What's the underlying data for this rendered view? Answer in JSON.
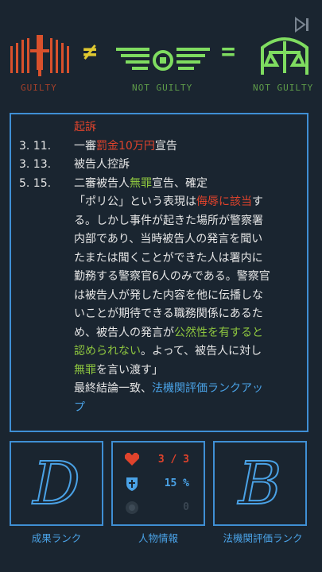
{
  "verdict_bar": {
    "guilty_label": "GUILTY",
    "not_equal_symbol": "≠",
    "not_guilty_label": "NOT GUILTY",
    "equals_symbol": "=",
    "result_label": "NOT GUILTY",
    "colors": {
      "guilty": "#d9512c",
      "not_guilty": "#7fdc60"
    },
    "icons": [
      "skip-icon",
      "guilty-sword-icon",
      "not-guilty-wings-icon",
      "not-guilty-scales-icon"
    ]
  },
  "record": {
    "header": "起訴",
    "entries": [
      {
        "date": "3. 11.",
        "parts": [
          {
            "t": "一審"
          },
          {
            "t": "罰金10万円",
            "c": "red"
          },
          {
            "t": "宣告"
          }
        ]
      },
      {
        "date": "3. 13.",
        "parts": [
          {
            "t": "被告人控訴"
          }
        ]
      },
      {
        "date": "5. 15.",
        "parts": [
          {
            "t": "二審被告人"
          },
          {
            "t": "無罪",
            "c": "green"
          },
          {
            "t": "宣告、確定"
          }
        ]
      }
    ],
    "judgment_lines": [
      [
        {
          "t": "「ポリ公」という表現は"
        },
        {
          "t": "侮辱に該当",
          "c": "red"
        },
        {
          "t": "す"
        }
      ],
      [
        {
          "t": "る。しかし事件が起きた場所が警察署"
        }
      ],
      [
        {
          "t": "内部であり、当時被告人の発言を聞い"
        }
      ],
      [
        {
          "t": "たまたは聞くことができた人は署内に"
        }
      ],
      [
        {
          "t": "勤務する警察官6人のみである。警察官"
        }
      ],
      [
        {
          "t": "は被告人が発した内容を他に伝播しな"
        }
      ],
      [
        {
          "t": "いことが期待できる職務関係にあるた"
        }
      ],
      [
        {
          "t": "め、被告人の発言が"
        },
        {
          "t": "公然性を有すると",
          "c": "green"
        }
      ],
      [
        {
          "t": "認められない",
          "c": "green"
        },
        {
          "t": "。よって、被告人に対し"
        }
      ],
      [
        {
          "t": "無罪",
          "c": "green"
        },
        {
          "t": "を言い渡す」"
        }
      ],
      [
        {
          "t": "最終結論一致、"
        },
        {
          "t": "法機関評価ランクアッ",
          "c": "blue"
        }
      ],
      [
        {
          "t": "プ",
          "c": "blue"
        }
      ]
    ]
  },
  "panels": {
    "result_rank": {
      "letter": "D",
      "label": "成果ランク"
    },
    "character": {
      "label": "人物情報",
      "hp_text": "3 / 3",
      "defense_text": "15 %",
      "coin_text": "0",
      "icons": [
        "heart-icon",
        "shield-icon",
        "coin-icon"
      ],
      "colors": {
        "hp": "#e0432c",
        "defense": "#4aa2e6",
        "coin": "#3a4652"
      }
    },
    "agency_rank": {
      "letter": "B",
      "label": "法機関評価ランク"
    }
  }
}
